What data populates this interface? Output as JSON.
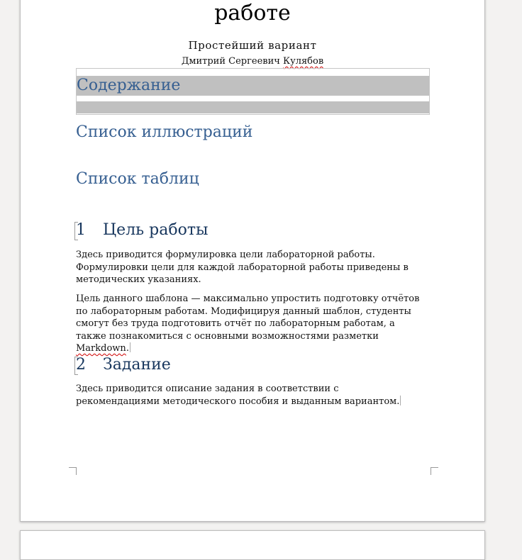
{
  "document": {
    "title_line": "работе",
    "subtitle": "Простейший вариант",
    "author_first": "Дмитрий Сергеевич ",
    "author_last": "Кулябов"
  },
  "toc": {
    "heading": "Содержание"
  },
  "lists": {
    "figures": "Список иллюстраций",
    "tables": "Список таблиц"
  },
  "sections": [
    {
      "number": "1",
      "title": "Цель работы",
      "paragraphs": [
        "Здесь приводится формулировка цели лабораторной работы. Формулировки цели для каждой лабораторной работы приведены в методических указаниях.",
        "Цель данного шаблона — максимально упростить подготовку отчётов по лабораторным работам. Модифицируя данный шаблон, студенты смогут без труда подготовить отчёт по лабораторным работам, а также познакомиться с основными возможностями разметки "
      ],
      "paragraph_tail_word": "Markdown",
      "paragraph_tail_end": "."
    },
    {
      "number": "2",
      "title": "Задание",
      "paragraphs": [
        "Здесь приводится описание задания в соответствии с рекомендациями методического пособия и выданным вариантом."
      ]
    }
  ]
}
